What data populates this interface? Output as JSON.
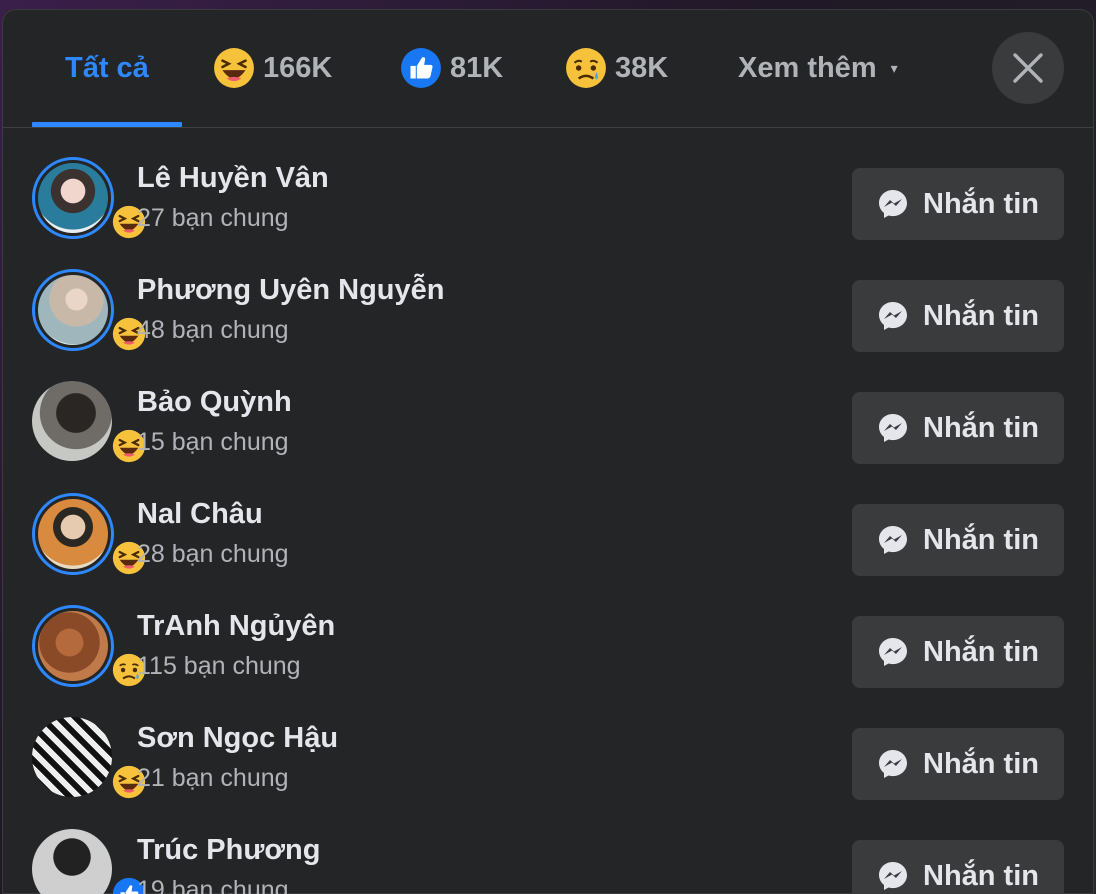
{
  "tabs": {
    "all_label": "Tất cả",
    "haha_count": "166K",
    "like_count": "81K",
    "sad_count": "38K",
    "more_label": "Xem thêm"
  },
  "people": [
    {
      "name": "Lê Huyền Vân",
      "mutual": "27 bạn chung",
      "reaction": "haha",
      "story_ring": true
    },
    {
      "name": "Phương Uyên Nguyễn",
      "mutual": "48 bạn chung",
      "reaction": "haha",
      "story_ring": true
    },
    {
      "name": "Bảo Quỳnh",
      "mutual": "15 bạn chung",
      "reaction": "haha",
      "story_ring": false
    },
    {
      "name": "Nal Châu",
      "mutual": "28 bạn chung",
      "reaction": "haha",
      "story_ring": true
    },
    {
      "name": "TrAnh Ngủyên",
      "mutual": "115 bạn chung",
      "reaction": "sad",
      "story_ring": true
    },
    {
      "name": "Sơn Ngọc Hậu",
      "mutual": "21 bạn chung",
      "reaction": "haha",
      "story_ring": false
    },
    {
      "name": "Trúc Phương",
      "mutual": "19 bạn chung",
      "reaction": "like",
      "story_ring": false
    }
  ],
  "message_button_label": "Nhắn tin",
  "icons": {
    "haha": "haha-emoji-icon",
    "like": "like-emoji-icon",
    "sad": "sad-emoji-icon",
    "close": "close-icon",
    "messenger": "messenger-icon"
  },
  "colors": {
    "accent": "#2d88ff",
    "background": "#242526",
    "button": "#3a3b3c",
    "text_primary": "#e4e6eb",
    "text_secondary": "#b0b3b8"
  }
}
